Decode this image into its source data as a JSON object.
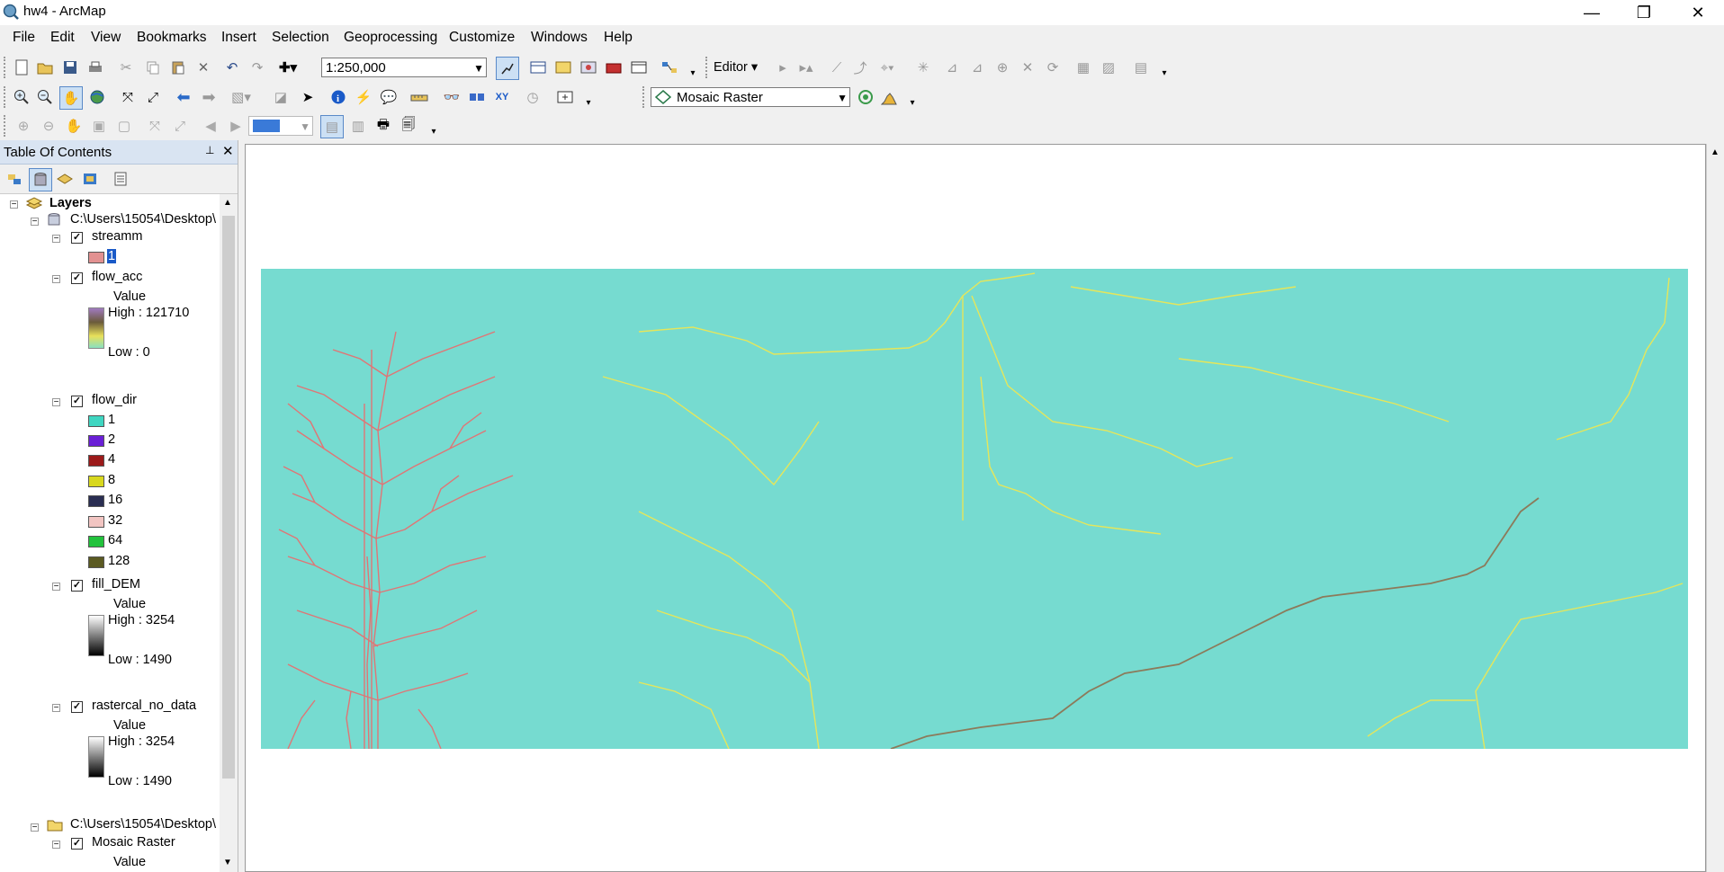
{
  "window": {
    "title": "hw4 - ArcMap",
    "min": "—",
    "restore": "❐",
    "close": "✕"
  },
  "menu": [
    "File",
    "Edit",
    "View",
    "Bookmarks",
    "Insert",
    "Selection",
    "Geoprocessing",
    "Customize",
    "Windows",
    "Help"
  ],
  "toolbar": {
    "scale": "1:250,000",
    "editor_label": "Editor ▾",
    "layer_combo": "Mosaic Raster"
  },
  "toc": {
    "title": "Table Of Contents",
    "pin": "📌",
    "close": "✕",
    "root": "Layers",
    "workspace1": "C:\\Users\\15054\\Desktop\\",
    "workspace2": "C:\\Users\\15054\\Desktop\\",
    "streamm": {
      "name": "streamm",
      "value": "1",
      "color": "#e29191"
    },
    "flow_acc": {
      "name": "flow_acc",
      "value_label": "Value",
      "high": "High : 121710",
      "low": "Low : 0"
    },
    "flow_dir": {
      "name": "flow_dir",
      "classes": [
        {
          "label": "1",
          "color": "#3fd6c1"
        },
        {
          "label": "2",
          "color": "#6a1fd6"
        },
        {
          "label": "4",
          "color": "#9c1a1a"
        },
        {
          "label": "8",
          "color": "#d8d81e"
        },
        {
          "label": "16",
          "color": "#2a2e52"
        },
        {
          "label": "32",
          "color": "#f2c5c2"
        },
        {
          "label": "64",
          "color": "#22c23c"
        },
        {
          "label": "128",
          "color": "#5b5a22"
        }
      ]
    },
    "fill_dem": {
      "name": "fill_DEM",
      "value_label": "Value",
      "high": "High : 3254",
      "low": "Low : 1490"
    },
    "rastercal": {
      "name": "rastercal_no_data",
      "value_label": "Value",
      "high": "High : 3254",
      "low": "Low : 1490"
    },
    "mosaic": {
      "name": "Mosaic Raster",
      "value_label": "Value"
    }
  },
  "colors": {
    "raster_fill": "#76dbd0",
    "stream": "#e07575",
    "flow_yellow": "#e6e65a"
  }
}
